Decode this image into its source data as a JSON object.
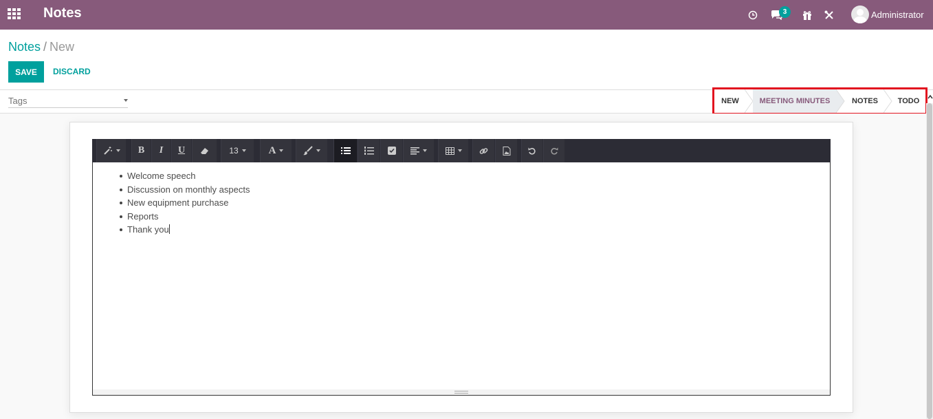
{
  "navbar": {
    "app_title": "Notes",
    "messages_count": "3",
    "user_name": "Administrator",
    "icons": [
      "apps-grid-icon",
      "clock-icon",
      "chat-icon",
      "gift-icon",
      "tools-icon",
      "avatar"
    ]
  },
  "breadcrumb": {
    "parent": "Notes",
    "separator": "/",
    "current": "New"
  },
  "buttons": {
    "save": "SAVE",
    "discard": "DISCARD"
  },
  "tags": {
    "placeholder": "Tags"
  },
  "stages": [
    {
      "label": "NEW",
      "active": false
    },
    {
      "label": "MEETING MINUTES",
      "active": true
    },
    {
      "label": "NOTES",
      "active": false
    },
    {
      "label": "TODO",
      "active": false
    }
  ],
  "toolbar": {
    "font_size": "13",
    "bold": "B",
    "italic": "I",
    "underline": "U",
    "font_color": "A"
  },
  "editor": {
    "items": [
      "Welcome speech",
      "Discussion on monthly aspects",
      "New equipment purchase",
      "Reports",
      "Thank you"
    ]
  },
  "colors": {
    "brand": "#875a7b",
    "accent": "#00a09d",
    "highlight": "#e2131f"
  }
}
